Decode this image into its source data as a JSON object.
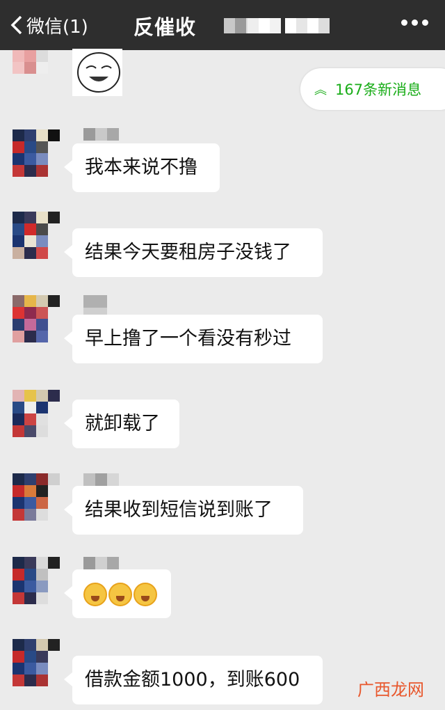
{
  "header": {
    "back_label": "微信(1)",
    "title": "反催收",
    "more_icon": "more-dots-icon"
  },
  "new_messages": {
    "label": "167条新消息",
    "icon": "double-chevron-up-icon",
    "color": "#1aad19"
  },
  "messages": [
    {
      "text": "我本来说不撸"
    },
    {
      "text": "结果今天要租房子没钱了"
    },
    {
      "text": "早上撸了一个看没有秒过"
    },
    {
      "text": "就卸载了"
    },
    {
      "text": "结果收到短信说到账了"
    },
    {
      "text": "",
      "emojis": [
        "crying-laughing-emoji",
        "crying-laughing-emoji",
        "crying-laughing-emoji"
      ]
    },
    {
      "text": "借款金额1000，到账600"
    }
  ],
  "watermark": "广西龙网"
}
